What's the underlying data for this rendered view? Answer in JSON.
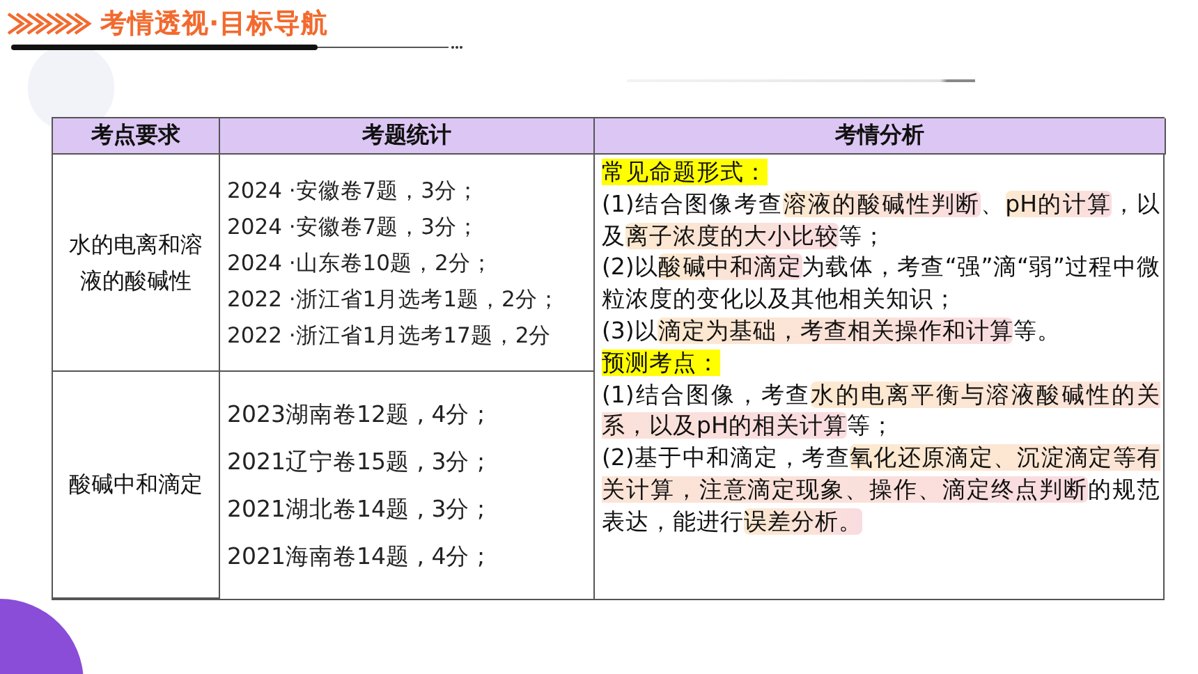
{
  "title": "考情透视·目标导航",
  "table": {
    "columns": [
      "考点要求",
      "考题统计",
      "考情分析"
    ],
    "rows": [
      {
        "requirement": "水的电离和溶液的酸碱性",
        "stats": [
          "2024 ·安徽卷7题，3分；",
          "2024 ·安徽卷7题，3分；",
          "2024 ·山东卷10题，2分；",
          "2022 ·浙江省1月选考1题，2分；",
          "2022 ·浙江省1月选考17题，2分"
        ]
      },
      {
        "requirement": "酸碱中和滴定",
        "stats": [
          "2023湖南卷12题 , 4分 ;",
          "2021辽宁卷15题 , 3分 ;",
          "2021湖北卷14题 , 3分 ;",
          "2021海南卷14题 , 4分 ;"
        ]
      }
    ],
    "analysis": [
      {
        "kind": "heading",
        "segments": [
          {
            "text": "常见命题形式：",
            "highlight": false
          }
        ]
      },
      {
        "kind": "paragraph",
        "segments": [
          {
            "text": "(1)结合图像考查",
            "highlight": false
          },
          {
            "text": "溶液的酸碱性判断",
            "highlight": true
          },
          {
            "text": "、",
            "highlight": false
          },
          {
            "text": "pH的计算",
            "highlight": true
          },
          {
            "text": "，以及",
            "highlight": false
          },
          {
            "text": "离子浓度的大小比较",
            "highlight": true
          },
          {
            "text": "等；",
            "highlight": false
          }
        ]
      },
      {
        "kind": "paragraph",
        "segments": [
          {
            "text": "(2)以",
            "highlight": false
          },
          {
            "text": "酸碱中和滴定",
            "highlight": true
          },
          {
            "text": "为载体，考查“强”滴“弱”过程中微粒浓度的变化以及其他相关知识；",
            "highlight": false
          }
        ]
      },
      {
        "kind": "paragraph",
        "segments": [
          {
            "text": "(3)以",
            "highlight": false
          },
          {
            "text": "滴定为基础，考查相关操作和计算",
            "highlight": true
          },
          {
            "text": "等。",
            "highlight": false
          }
        ]
      },
      {
        "kind": "heading",
        "segments": [
          {
            "text": "预测考点：",
            "highlight": false
          }
        ]
      },
      {
        "kind": "paragraph",
        "segments": [
          {
            "text": "(1)结合图像，考查",
            "highlight": false
          },
          {
            "text": "水的电离平衡与溶液酸碱性的关系，以及pH的相关计算",
            "highlight": true
          },
          {
            "text": "等；",
            "highlight": false
          }
        ]
      },
      {
        "kind": "paragraph",
        "segments": [
          {
            "text": "(2)基于中和滴定，考查",
            "highlight": false
          },
          {
            "text": "氧化还原滴定、沉淀滴定等有关计算，注意滴定现象、操作、滴定终点判断",
            "highlight": true
          },
          {
            "text": "的规范表达，能进行",
            "highlight": false
          },
          {
            "text": "误差分析。",
            "highlight": true
          }
        ]
      }
    ]
  }
}
